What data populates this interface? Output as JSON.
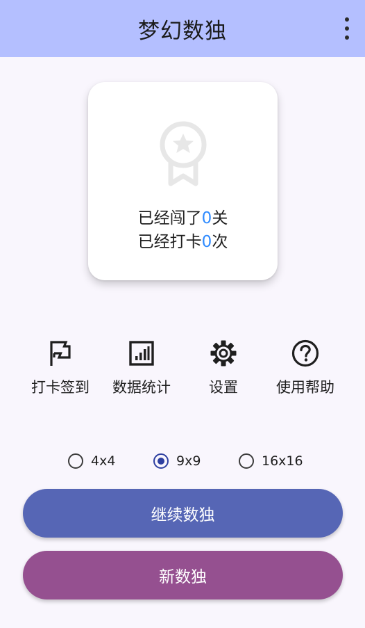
{
  "app_bar": {
    "title": "梦幻数独",
    "menu_icon": "more-vert-icon"
  },
  "stats_card": {
    "icon": "medal-icon",
    "levels_prefix": "已经闯了",
    "levels_count": "0",
    "levels_suffix": "关",
    "checkin_prefix": "已经打卡",
    "checkin_count": "0",
    "checkin_suffix": "次",
    "count_color": "#2f8bff"
  },
  "actions": [
    {
      "label": "打卡签到",
      "icon": "flag-icon"
    },
    {
      "label": "数据统计",
      "icon": "stats-icon"
    },
    {
      "label": "设置",
      "icon": "gear-icon"
    },
    {
      "label": "使用帮助",
      "icon": "help-icon"
    }
  ],
  "grid_size": {
    "options": [
      "4x4",
      "9x9",
      "16x16"
    ],
    "selected": "9x9"
  },
  "buttons": {
    "continue_label": "继续数独",
    "new_label": "新数独"
  },
  "colors": {
    "app_bar": "#b4bfff",
    "continue_button": "#5666b5",
    "new_button": "#955090",
    "radio_selected": "#2d3fa0"
  }
}
